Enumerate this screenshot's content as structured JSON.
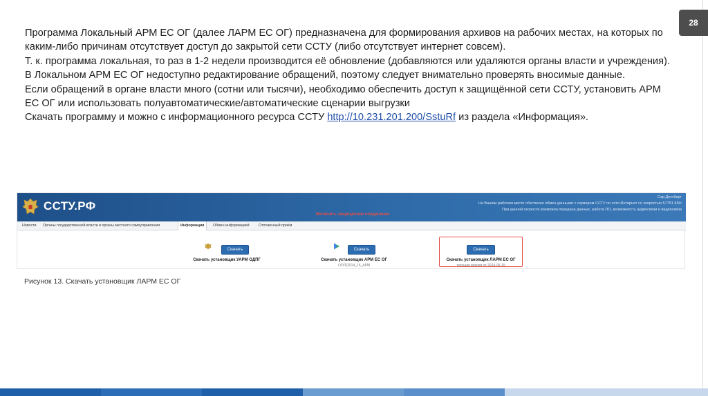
{
  "slide": {
    "page_number": "28",
    "paragraphs": [
      "Программа Локальный АРМ ЕС ОГ (далее ЛАРМ ЕС ОГ) предназначена для формирования архивов на рабочих местах, на которых по каким-либо причинам отсутствует доступ до закрытой сети ССТУ (либо отсутствует интернет совсем).",
      "Т. к. программа локальная, то раз в 1-2 недели производится её обновление (добавляются или удаляются органы власти и учреждения).",
      "В Локальном АРМ ЕС ОГ недоступно редактирование обращений, поэтому следует внимательно проверять вносимые данные.",
      "Если обращений в органе власти много (сотни или тысячи), необходимо обеспечить доступ к защищённой сети ССТУ, установить АРМ ЕС ОГ или использовать полуавтоматические/автоматические сценарии выгрузки"
    ],
    "download_line": {
      "prefix": "Скачать программу и можно с информационного ресурса ССТУ ",
      "link": "http://10.231.201.200/SstuRf",
      "suffix": " из раздела «Информация»."
    },
    "caption": "Рисунок 13. Скачать установщик  ЛАРМ ЕС ОГ"
  },
  "site": {
    "name": "ССТУ.РФ",
    "user": "Сар.Дегобирт",
    "note1": "На Вашем рабочем месте обеспечен обмен данными с сервером ССТУ по сети Интернет со скоростью 57751 Кб/с",
    "note2": "При данной скорости возможна передача данных, работа ПО, возможность аудиосвязи и видеосвязи",
    "warning": "Включить защищённое соединение",
    "nav": [
      "Новости",
      "Органы государственной власти и органы местного самоуправления",
      "Информация",
      "Обмен информацией",
      "Отложенный приём"
    ],
    "downloads": [
      {
        "button": "Скачать",
        "title": "Скачать установщик УАРМ ОДПГ",
        "sub": ""
      },
      {
        "button": "Скачать",
        "title": "Скачать установщик АРМ ЕС ОГ",
        "sub": "ООП(2014_15_АРМ"
      },
      {
        "button": "Скачать",
        "title": "Скачать установщик ЛАРМ ЕС ОГ",
        "sub": "текущая версия от 2024-05-15"
      }
    ]
  },
  "colors": {
    "header_blue": "#2e6aa8",
    "button_blue": "#2c6cb0",
    "highlight_red": "#e24b43",
    "bottom_bar": [
      "#1f5ea8",
      "#2b6db6",
      "#1f5ea8",
      "#6a9bd1",
      "#5b8fcb",
      "#c8d8ec"
    ]
  }
}
